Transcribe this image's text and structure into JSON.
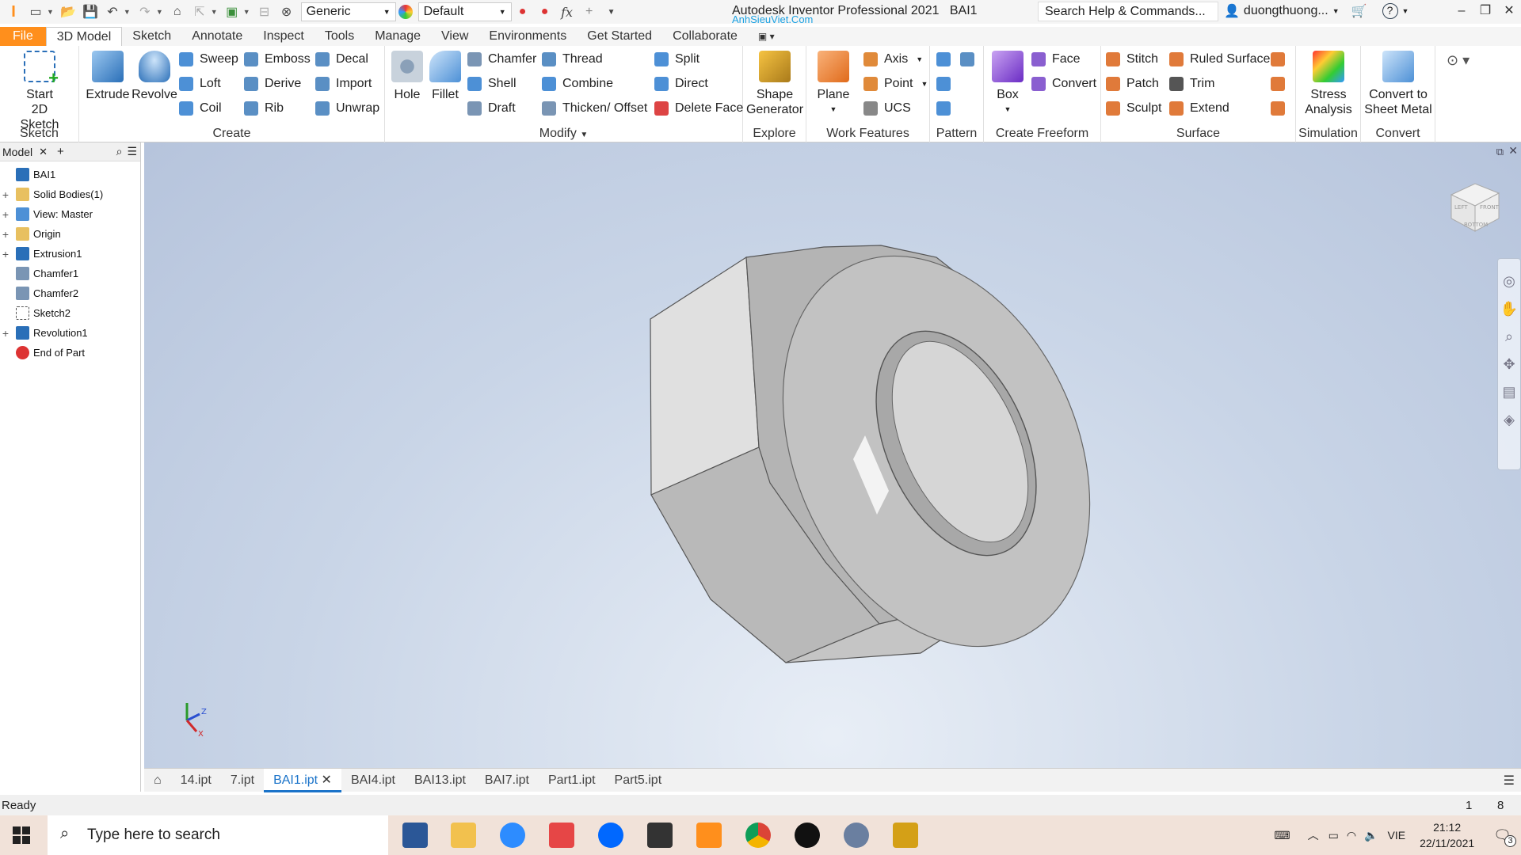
{
  "app": {
    "title": "Autodesk Inventor Professional 2021",
    "doc": "BAI1",
    "watermark": "AnhSieuViet.Com",
    "search_placeholder": "Search Help & Commands...",
    "user": "duongthuong...",
    "material": "Generic",
    "appearance": "Default"
  },
  "tabs": [
    "File",
    "3D Model",
    "Sketch",
    "Annotate",
    "Inspect",
    "Tools",
    "Manage",
    "View",
    "Environments",
    "Get Started",
    "Collaborate"
  ],
  "ribbon": {
    "sketch": {
      "label": "Sketch",
      "start": "Start",
      "start2": "2D Sketch"
    },
    "create": {
      "label": "Create",
      "extrude": "Extrude",
      "revolve": "Revolve",
      "sweep": "Sweep",
      "loft": "Loft",
      "coil": "Coil",
      "emboss": "Emboss",
      "derive": "Derive",
      "rib": "Rib",
      "decal": "Decal",
      "import": "Import",
      "unwrap": "Unwrap"
    },
    "modify": {
      "label": "Modify",
      "hole": "Hole",
      "fillet": "Fillet",
      "chamfer": "Chamfer",
      "shell": "Shell",
      "draft": "Draft",
      "thread": "Thread",
      "combine": "Combine",
      "thicken": "Thicken/ Offset",
      "split": "Split",
      "direct": "Direct",
      "delete_face": "Delete Face"
    },
    "explore": {
      "label": "Explore",
      "shape1": "Shape",
      "shape2": "Generator"
    },
    "work": {
      "label": "Work Features",
      "plane": "Plane",
      "axis": "Axis",
      "point": "Point",
      "ucs": "UCS"
    },
    "pattern": {
      "label": "Pattern"
    },
    "freeform": {
      "label": "Create Freeform",
      "box": "Box",
      "face": "Face",
      "convert": "Convert"
    },
    "surface": {
      "label": "Surface",
      "stitch": "Stitch",
      "patch": "Patch",
      "sculpt": "Sculpt",
      "ruled": "Ruled Surface",
      "trim": "Trim",
      "extend": "Extend"
    },
    "simulation": {
      "label": "Simulation",
      "stress1": "Stress",
      "stress2": "Analysis"
    },
    "convert": {
      "label": "Convert",
      "c1": "Convert to",
      "c2": "Sheet Metal"
    }
  },
  "browser": {
    "tab": "Model",
    "nodes": [
      "BAI1",
      "Solid Bodies(1)",
      "View: Master",
      "Origin",
      "Extrusion1",
      "Chamfer1",
      "Chamfer2",
      "Sketch2",
      "Revolution1",
      "End of Part"
    ]
  },
  "viewcube": {
    "left": "LEFT",
    "front": "FRONT",
    "bottom": "BOTTOM"
  },
  "triad": {
    "z": "Z",
    "x": "X"
  },
  "doc_tabs": [
    "14.ipt",
    "7.ipt",
    "BAI1.ipt",
    "BAI4.ipt",
    "BAI13.ipt",
    "BAI7.ipt",
    "Part1.ipt",
    "Part5.ipt"
  ],
  "status": {
    "text": "Ready",
    "n1": "1",
    "n2": "8"
  },
  "taskbar": {
    "search": "Type here to search",
    "lang": "VIE",
    "time": "21:12",
    "date": "22/11/2021",
    "notif": "3"
  }
}
